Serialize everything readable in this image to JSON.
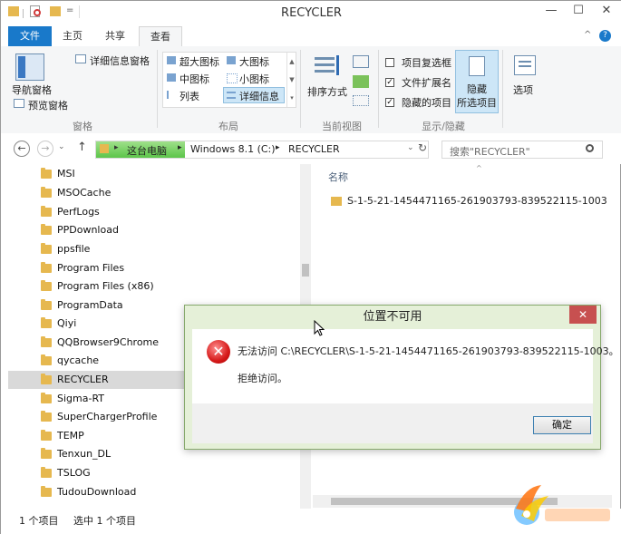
{
  "window": {
    "title": "RECYCLER",
    "minimize": "—",
    "maximize": "☐",
    "close": "✕",
    "qat_dropdown": "="
  },
  "tabs": [
    {
      "label": "文件"
    },
    {
      "label": "主页"
    },
    {
      "label": "共享"
    },
    {
      "label": "查看"
    }
  ],
  "ribbon_right": {
    "collapse": "^",
    "help": "?"
  },
  "ribbon": {
    "panes": {
      "label": "窗格",
      "nav_pane": "导航窗格",
      "details_pane": "详细信息窗格",
      "preview_pane": "预览窗格"
    },
    "layout": {
      "label": "布局",
      "items": [
        "超大图标",
        "大图标",
        "中图标",
        "小图标",
        "列表",
        "详细信息"
      ]
    },
    "current_view": {
      "label": "当前视图",
      "sort": "排序方式"
    },
    "show_hide": {
      "label": "显示/隐藏",
      "item_checkboxes": "项目复选框",
      "item_checkboxes_checked": false,
      "file_extensions": "文件扩展名",
      "file_extensions_checked": true,
      "hidden_items": "隐藏的项目",
      "hidden_items_checked": true,
      "hide_selected_line1": "隐藏",
      "hide_selected_line2": "所选项目"
    },
    "options": "选项"
  },
  "address": {
    "crumbs": [
      "这台电脑",
      "Windows 8.1 (C:)",
      "RECYCLER"
    ],
    "separator": "▸",
    "search_placeholder": "搜索\"RECYCLER\"",
    "back": "←",
    "forward": "→",
    "up": "↑",
    "refresh": "↻",
    "dropdown": "⌄"
  },
  "nav_items": [
    "MSI",
    "MSOCache",
    "PerfLogs",
    "PPDownload",
    "ppsfile",
    "Program Files",
    "Program Files (x86)",
    "ProgramData",
    "Qiyi",
    "QQBrowser9Chrome",
    "qycache",
    "RECYCLER",
    "Sigma-RT",
    "SuperChargerProfile",
    "TEMP",
    "Tenxun_DL",
    "TSLOG",
    "TudouDownload"
  ],
  "content": {
    "column_name": "名称",
    "sort_arrow": "^",
    "file": "S-1-5-21-1454471165-261903793-839522115-1003"
  },
  "status": {
    "count": "1 个项目",
    "selected": "选中 1 个项目"
  },
  "dialog": {
    "title": "位置不可用",
    "message": "无法访问 C:\\RECYCLER\\S-1-5-21-1454471165-261903793-839522115-1003。",
    "detail": "拒绝访问。",
    "ok": "确定",
    "close": "✕",
    "error_glyph": "✕"
  },
  "colors": {
    "file_tab": "#1979ca",
    "dialog_frame": "#e5f0d8",
    "close_red": "#c75050"
  }
}
